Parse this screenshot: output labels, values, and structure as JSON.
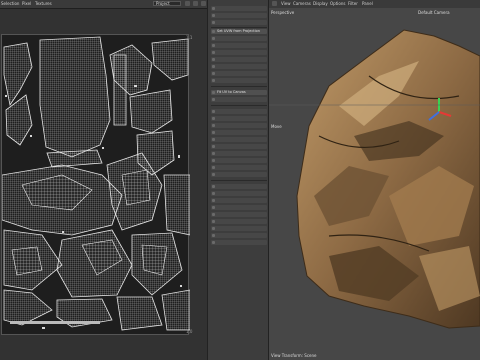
{
  "uv_editor": {
    "menu": [
      "Selection",
      "Pixel",
      "Textures"
    ],
    "dropdown_value": "Project",
    "corner_top_right": "1,1",
    "corner_bottom_right": "1,0"
  },
  "tools": {
    "items": [
      {
        "label": "Set UVW from Projection",
        "hi": true
      },
      {
        "label": "Fit UV to Canvas",
        "hi": true
      }
    ]
  },
  "viewport": {
    "menu": [
      "View",
      "Cameras",
      "Display",
      "Options",
      "Filter",
      "Panel"
    ],
    "view_name": "Perspective",
    "camera": "Default Camera",
    "side_label": "Move",
    "status": "View Transform: Scene"
  },
  "colors": {
    "accent": "#4a90d9",
    "rock_light": "#b58c5c",
    "rock_dark": "#5a4128"
  }
}
